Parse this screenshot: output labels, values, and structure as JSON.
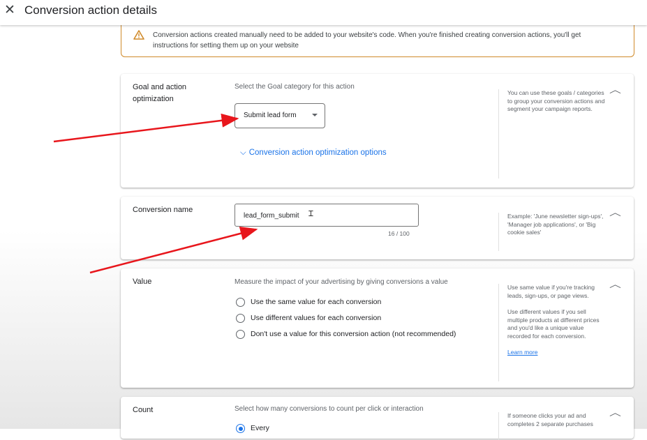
{
  "header": {
    "close_icon": "close-icon",
    "title": "Conversion action details"
  },
  "notice": {
    "icon": "warning-icon",
    "text": "Conversion actions created manually need to be added to your website's code. When you're finished creating conversion actions, you'll get instructions for setting them up on your website"
  },
  "goal": {
    "label": "Goal and action optimization",
    "description": "Select the Goal category for this action",
    "selected": "Submit lead form",
    "expand_link": "Conversion action optimization options",
    "help": "You can use these goals / categories to group your conversion actions and segment your campaign reports."
  },
  "conversion_name": {
    "label": "Conversion name",
    "value": "lead_form_submit",
    "counter": "16 / 100",
    "help": "Example: 'June newsletter sign-ups', 'Manager job applications', or 'Big cookie sales'"
  },
  "value": {
    "label": "Value",
    "description": "Measure the impact of your advertising by giving conversions a value",
    "options": [
      "Use the same value for each conversion",
      "Use different values for each conversion",
      "Don't use a value for this conversion action (not recommended)"
    ],
    "help1": "Use same value if you're tracking leads, sign-ups, or page views.",
    "help2": "Use different values if you sell multiple products at different prices and you'd like a unique value recorded for each conversion.",
    "learn_more": "Learn more"
  },
  "count": {
    "label": "Count",
    "description": "Select how many conversions to count per click or interaction",
    "option_every": "Every",
    "help": "If someone clicks your ad and completes 2 separate purchases"
  },
  "colors": {
    "accent": "#1a73e8",
    "warning": "#d08a2a",
    "annotation_arrow": "#e8161c"
  }
}
